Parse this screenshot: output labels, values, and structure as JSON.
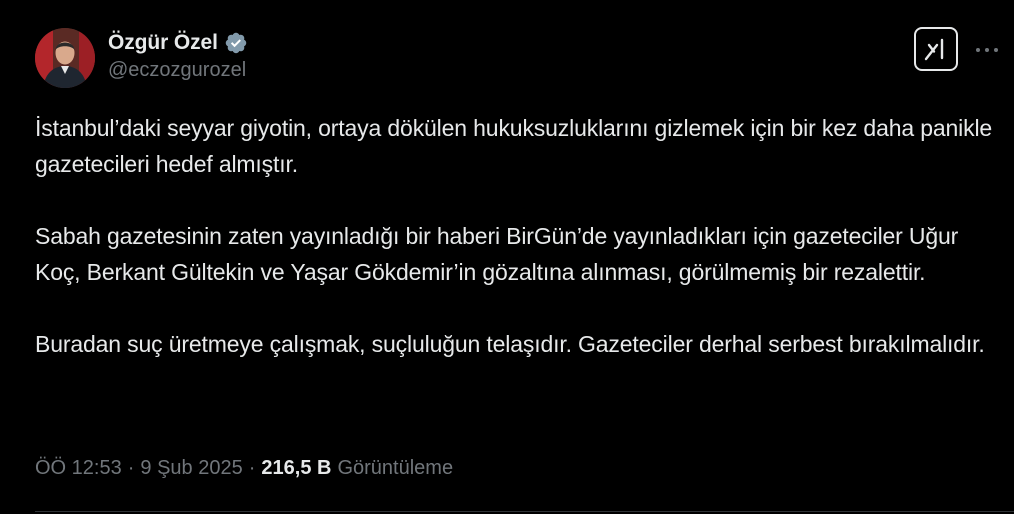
{
  "author": {
    "display_name": "Özgür Özel",
    "handle": "@eczozgurozel",
    "verified": true
  },
  "icons": {
    "verified": "verified-badge-icon",
    "grok": "grok-icon",
    "more": "more-options-icon"
  },
  "colors": {
    "background": "#000000",
    "text_primary": "#e7e9ea",
    "text_secondary": "#71767b",
    "divider": "#2f3336"
  },
  "tweet": {
    "paragraphs": [
      "İstanbul’daki seyyar giyotin, ortaya dökülen hukuksuzluklarını gizlemek için bir kez daha panikle gazetecileri hedef almıştır.",
      "Sabah gazetesinin zaten yayınladığı bir haberi BirGün’de yayınladıkları için gazeteciler Uğur Koç, Berkant Gültekin ve Yaşar Gökdemir’in gözaltına alınması, görülmemiş bir rezalettir.",
      "Buradan suç üretmeye çalışmak, suçluluğun telaşıdır. Gazeteciler derhal serbest bırakılmalıdır."
    ]
  },
  "meta": {
    "time": "ÖÖ 12:53",
    "separator": "·",
    "date": "9 Şub 2025",
    "views_count": "216,5 B",
    "views_label": "Görüntüleme"
  }
}
